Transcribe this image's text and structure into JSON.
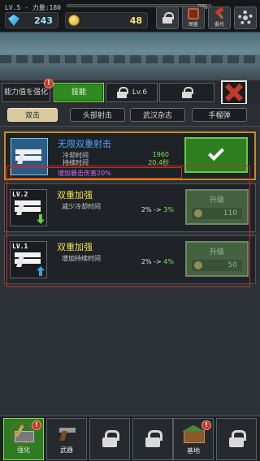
{
  "hud": {
    "level_text": "LV.5 - 力量:180",
    "xp_percent_label": "0%",
    "xp_fraction": 0.0,
    "gems": "243",
    "coins": "48",
    "btn_book_label": "图鉴",
    "btn_commission_label": "委托"
  },
  "tabs_top": [
    {
      "label": "能力值を强化",
      "badge": "!"
    },
    {
      "label": "技能"
    },
    {
      "label": "Lv.6"
    },
    {
      "label": ""
    }
  ],
  "tabs_sub": [
    "双击",
    "头部射击",
    "武汉杂志",
    "手榴弹"
  ],
  "cards": [
    {
      "name": "无限双重射击",
      "stat1_label": "冷却时间",
      "stat1_value": "1960",
      "stat2_label": "持续时间",
      "stat2_value": "20.4秒",
      "extra": "增加暴击伤害20%"
    },
    {
      "level": "LV.2",
      "name": "双重加强",
      "desc": "减少冷却时间",
      "from": "2%",
      "arrow": "->",
      "to": "3%",
      "button_label": "升级",
      "cost": "110"
    },
    {
      "level": "LV.1",
      "name": "双重加强",
      "desc": "增加持续时间",
      "from": "2%",
      "arrow": "->",
      "to": "4%",
      "button_label": "升级",
      "cost": "50"
    }
  ],
  "bottom_nav": [
    {
      "label": "强化",
      "badge": "!"
    },
    {
      "label": "武器"
    },
    {
      "label": ""
    },
    {
      "label": ""
    },
    {
      "label": "基地",
      "badge": "!"
    },
    {
      "label": ""
    }
  ],
  "colors": {
    "accent_green": "#2f8a1f",
    "gold_border": "#c98a22",
    "warning_red": "#c0392b"
  }
}
